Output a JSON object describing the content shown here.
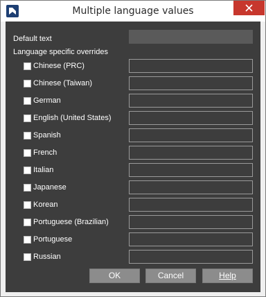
{
  "window": {
    "title": "Multiple language values",
    "app_icon": "app-icon",
    "close_icon": "close-icon",
    "accent_color": "#c7372d"
  },
  "default_text": {
    "label": "Default text",
    "value": ""
  },
  "overrides": {
    "heading": "Language specific overrides",
    "languages": [
      {
        "label": "Chinese (PRC)",
        "checked": false,
        "value": ""
      },
      {
        "label": "Chinese (Taiwan)",
        "checked": false,
        "value": ""
      },
      {
        "label": "German",
        "checked": false,
        "value": ""
      },
      {
        "label": "English (United States)",
        "checked": false,
        "value": ""
      },
      {
        "label": "Spanish",
        "checked": false,
        "value": ""
      },
      {
        "label": "French",
        "checked": false,
        "value": ""
      },
      {
        "label": "Italian",
        "checked": false,
        "value": ""
      },
      {
        "label": "Japanese",
        "checked": false,
        "value": ""
      },
      {
        "label": "Korean",
        "checked": false,
        "value": ""
      },
      {
        "label": "Portuguese (Brazilian)",
        "checked": false,
        "value": ""
      },
      {
        "label": "Portuguese",
        "checked": false,
        "value": ""
      },
      {
        "label": "Russian",
        "checked": false,
        "value": ""
      }
    ]
  },
  "buttons": {
    "ok": "OK",
    "cancel": "Cancel",
    "help": "Help"
  }
}
